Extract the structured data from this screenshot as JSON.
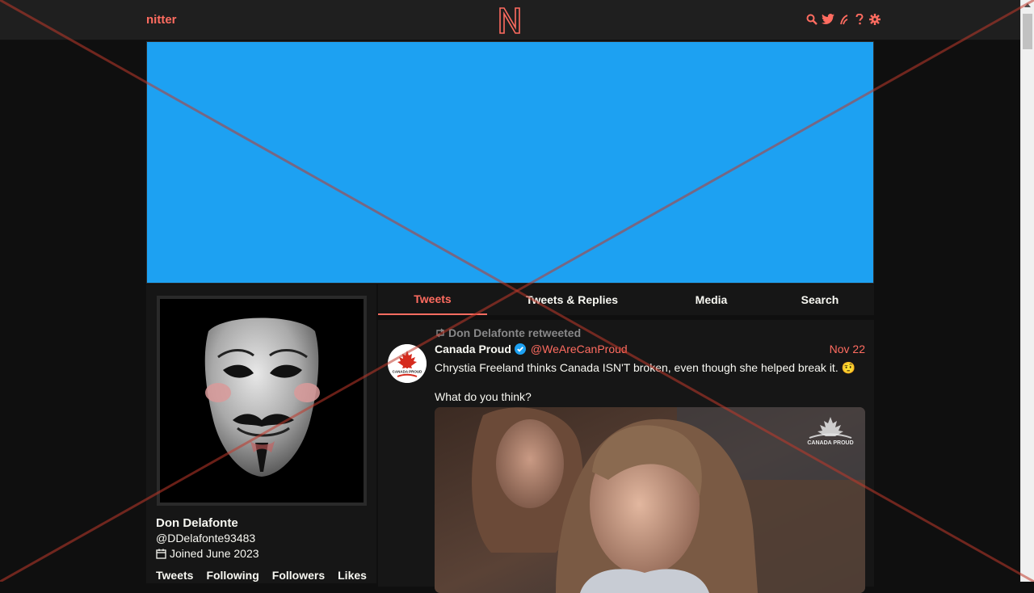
{
  "nav": {
    "brand": "nitter",
    "logo_letter": "N",
    "icons": [
      "search-icon",
      "twitter-icon",
      "rss-icon",
      "help-icon",
      "gear-icon"
    ]
  },
  "colors": {
    "accent": "#ff6c60",
    "background": "#0f0f0f",
    "panel": "#161616",
    "navbar": "#1f1f1f",
    "banner": "#1da1f2",
    "overlay_cross": "#c0392b"
  },
  "profile": {
    "fullname": "Don Delafonte",
    "username": "@DDelafonte93483",
    "joined": "Joined June 2023",
    "stats": [
      "Tweets",
      "Following",
      "Followers",
      "Likes"
    ]
  },
  "tabs": [
    {
      "label": "Tweets",
      "active": true
    },
    {
      "label": "Tweets & Replies",
      "active": false
    },
    {
      "label": "Media",
      "active": false
    },
    {
      "label": "Search",
      "active": false
    }
  ],
  "tweet": {
    "retweet_by": "Don Delafonte retweeted",
    "fullname": "Canada Proud",
    "verified": true,
    "handle": "@WeAreCanProud",
    "date": "Nov 22",
    "text_line1": "Chrystia Freeland thinks Canada ISN'T broken, even though she helped break it. 🤨",
    "text_line2": "What do you think?",
    "avatar_logo_text": "CANADA PROUD",
    "media_watermark": "CANADA PROUD"
  }
}
